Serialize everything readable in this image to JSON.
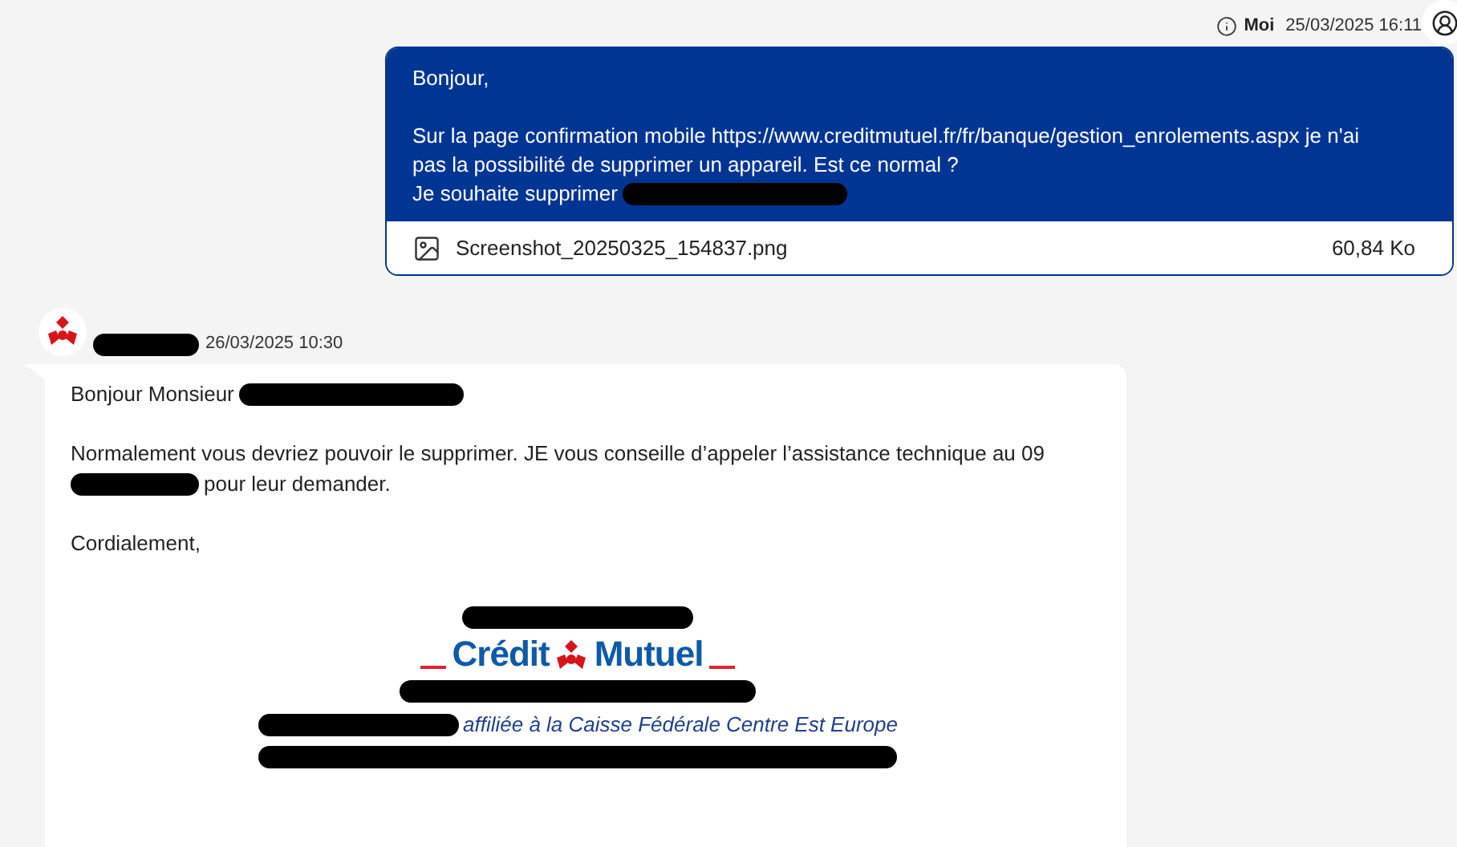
{
  "sent": {
    "author": "Moi",
    "time": "25/03/2025 16:11",
    "paragraphs": [
      [
        [
          {
            "kind": "text",
            "text": "Bonjour,"
          }
        ]
      ],
      [
        [
          {
            "kind": "text",
            "text": "Sur la page confirmation mobile https://www.creditmutuel.fr/fr/banque/gestion_enrolements.aspx je n'ai pas la possibilité de supprimer un appareil. Est ce normal ?"
          }
        ],
        [
          {
            "kind": "text",
            "text": "Je souhaite supprimer"
          },
          {
            "kind": "redaction"
          }
        ]
      ]
    ],
    "attachment": {
      "name": "Screenshot_20250325_154837.png",
      "size": "60,84 Ko"
    }
  },
  "received": {
    "time": "26/03/2025 10:30",
    "paragraphs": [
      [
        [
          {
            "kind": "text",
            "text": "Bonjour Monsieur"
          },
          {
            "kind": "redaction"
          }
        ]
      ],
      [
        [
          {
            "kind": "text",
            "text": "Normalement vous devriez pouvoir le supprimer. JE vous conseille d’appeler l’assistance technique au 09"
          }
        ],
        [
          {
            "kind": "redaction"
          },
          {
            "kind": "text",
            "text": "pour leur demander."
          }
        ]
      ],
      [
        [
          {
            "kind": "text",
            "text": "Cordialement,"
          }
        ]
      ]
    ],
    "signature": {
      "logo_left": "Crédit",
      "logo_right": "Mutuel",
      "affiliation": "affiliée à la Caisse Fédérale Centre Est Europe"
    }
  }
}
